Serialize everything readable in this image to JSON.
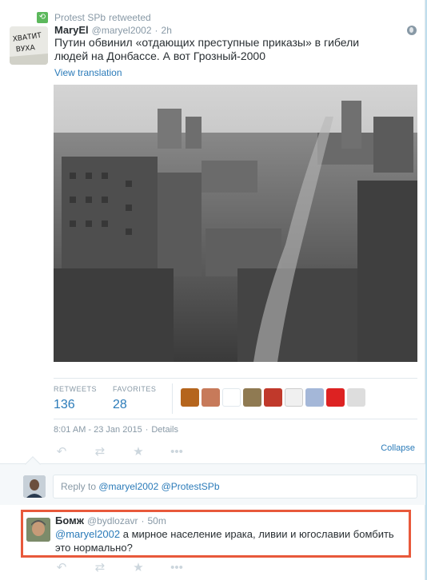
{
  "retweet_context": {
    "icon": "retweet-icon",
    "user": "Protest SPb",
    "action": "retweeted"
  },
  "tweet": {
    "author_name": "MaryEl",
    "author_handle": "@maryel2002",
    "separator": "·",
    "time": "2h",
    "text": "Путин обвинил «отдающих преступные приказы» в гибели людей на Донбассе. А вот Грозный-2000",
    "translation_link": "View translation",
    "avatar_text": "ХВАТИТ ВУХА",
    "stats": {
      "retweets_label": "RETWEETS",
      "retweets_value": "136",
      "favorites_label": "FAVORITES",
      "favorites_value": "28"
    },
    "timestamp": "8:01 AM - 23 Jan 2015",
    "timestamp_separator": "·",
    "details_link": "Details",
    "collapse_link": "Collapse"
  },
  "reply_box": {
    "prefix": "Reply to",
    "mention_1": "@maryel2002",
    "mention_2": "@ProtestSPb"
  },
  "reply_tweet": {
    "author_name": "Бомж",
    "author_handle": "@bydlozavr",
    "separator": "·",
    "time": "50m",
    "mention": "@maryel2002",
    "text": "а мирное население ирака, ливии и югославии бомбить это нормально?"
  },
  "colors": {
    "link": "#2b7bb9",
    "muted": "#8899a6",
    "highlight_border": "#e8593b",
    "retweet_green": "#5cb85c"
  }
}
